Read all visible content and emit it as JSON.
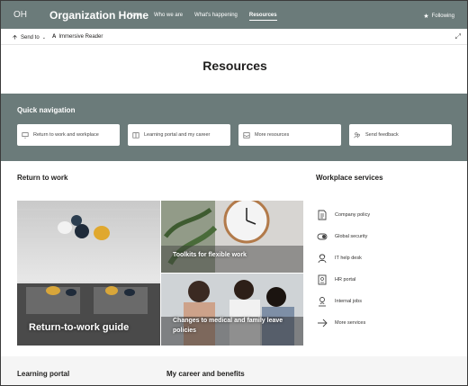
{
  "header": {
    "logo_text": "OH",
    "site_title": "Organization Home",
    "nav": [
      "Home",
      "Who we are",
      "What's happening",
      "Resources"
    ],
    "active_nav": "Resources",
    "follow_label": "Following"
  },
  "command_bar": {
    "send_to": "Send to",
    "immersive_reader": "Immersive Reader"
  },
  "page": {
    "title": "Resources"
  },
  "quick_navigation": {
    "label": "Quick navigation",
    "links": [
      {
        "label": "Return to work and workplace",
        "icon": "monitor-icon"
      },
      {
        "label": "Learning portal and my career",
        "icon": "book-icon"
      },
      {
        "label": "More resources",
        "icon": "tray-icon"
      },
      {
        "label": "Send feedback",
        "icon": "people-icon"
      }
    ]
  },
  "return_to_work": {
    "heading": "Return to work",
    "tiles": [
      {
        "caption": "Return-to-work guide"
      },
      {
        "caption": "Toolkits for flexible work"
      },
      {
        "caption": "Changes to medical and family leave policies"
      }
    ]
  },
  "workplace_services": {
    "heading": "Workplace services",
    "items": [
      {
        "label": "Company policy",
        "icon": "document-icon"
      },
      {
        "label": "Global security",
        "icon": "toggle-icon"
      },
      {
        "label": "IT help desk",
        "icon": "person-headset-icon"
      },
      {
        "label": "HR portal",
        "icon": "id-card-icon"
      },
      {
        "label": "Internal jobs",
        "icon": "person-pin-icon"
      },
      {
        "label": "More services",
        "icon": "arrow-right-icon"
      }
    ]
  },
  "bottom": {
    "learning_portal": "Learning portal",
    "my_career": "My career and benefits"
  },
  "colors": {
    "header_bg": "#6b7b7a",
    "band_bg": "#6b7b7a",
    "text": "#201f1e"
  }
}
